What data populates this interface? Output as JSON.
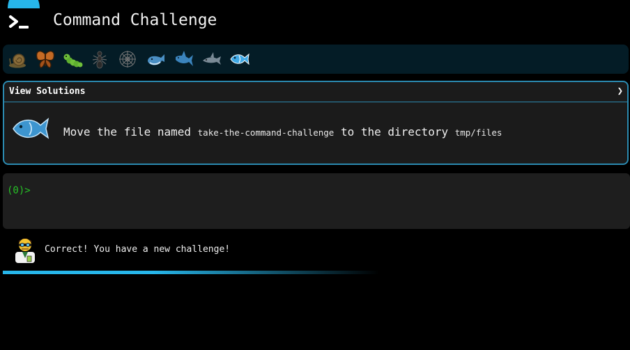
{
  "header": {
    "title": "Command Challenge",
    "logo_icon": "terminal-icon"
  },
  "levels": [
    {
      "icon": "snail-icon"
    },
    {
      "icon": "butterfly-icon"
    },
    {
      "icon": "caterpillar-icon"
    },
    {
      "icon": "ant-icon"
    },
    {
      "icon": "spiderweb-icon"
    },
    {
      "icon": "whale-icon"
    },
    {
      "icon": "shark-icon"
    },
    {
      "icon": "dolphin-icon"
    },
    {
      "icon": "fish-icon",
      "current": true
    }
  ],
  "panel": {
    "header_label": "View Solutions",
    "chevron": "❯",
    "icon": "fish-icon",
    "task_prefix": "Move the file named ",
    "file_name": "take-the-command-challenge",
    "task_middle": " to the directory ",
    "directory": "tmp/files"
  },
  "terminal": {
    "prompt": "(0)>"
  },
  "message": {
    "text": "Correct! You have a new challenge!",
    "avatar_icon": "scientist-avatar-icon"
  },
  "colors": {
    "accent": "#27b6ea",
    "prompt": "#27c227",
    "panel_border": "#2b8ab0"
  }
}
